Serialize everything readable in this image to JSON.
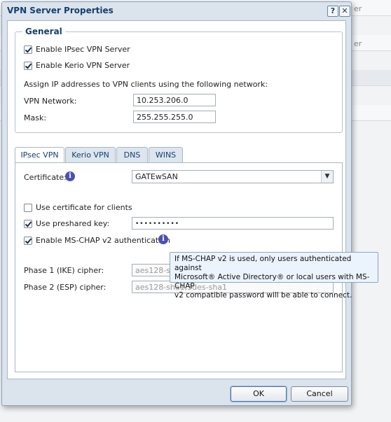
{
  "background": {
    "right_text_1": "er",
    "right_text_2": "er"
  },
  "dialog": {
    "title": "VPN Server Properties",
    "help_button": "?",
    "close_button": "✕"
  },
  "general": {
    "legend": "General",
    "enable_ipsec_label": "Enable IPsec VPN Server",
    "enable_ipsec_checked": true,
    "enable_kerio_label": "Enable Kerio VPN Server",
    "enable_kerio_checked": true,
    "assign_text": "Assign IP addresses to VPN clients using the following network:",
    "vpn_network_label": "VPN Network:",
    "vpn_network_value": "10.253.206.0",
    "mask_label": "Mask:",
    "mask_value": "255.255.255.0"
  },
  "tabs": [
    {
      "label": "IPsec VPN",
      "active": true
    },
    {
      "label": "Kerio VPN",
      "active": false
    },
    {
      "label": "DNS",
      "active": false
    },
    {
      "label": "WINS",
      "active": false
    }
  ],
  "ipsec": {
    "certificate_label": "Certificate:",
    "certificate_value": "GATEwSAN",
    "use_cert_label": "Use certificate for clients",
    "use_cert_checked": false,
    "use_psk_label": "Use preshared key:",
    "use_psk_checked": true,
    "psk_value": "••••••••••",
    "mschap_label": "Enable MS-CHAP v2 authentication",
    "mschap_checked": true,
    "phase1_label": "Phase 1 (IKE) cipher:",
    "phase1_value": "aes128-sha1",
    "phase2_label": "Phase 2 (ESP) cipher:",
    "phase2_value": "aes128-sha1,3des-sha1"
  },
  "tooltip": {
    "line1": "If MS-CHAP v2 is used, only users authenticated against",
    "line2": "Microsoft® Active Directory® or local users with MS-CHAP",
    "line3": "v2 compatible password will be able to connect."
  },
  "buttons": {
    "ok": "OK",
    "cancel": "Cancel"
  },
  "colors": {
    "accent": "#15406e",
    "info": "#4b4fb6",
    "tooltip_bg": "#ebf3fc"
  }
}
